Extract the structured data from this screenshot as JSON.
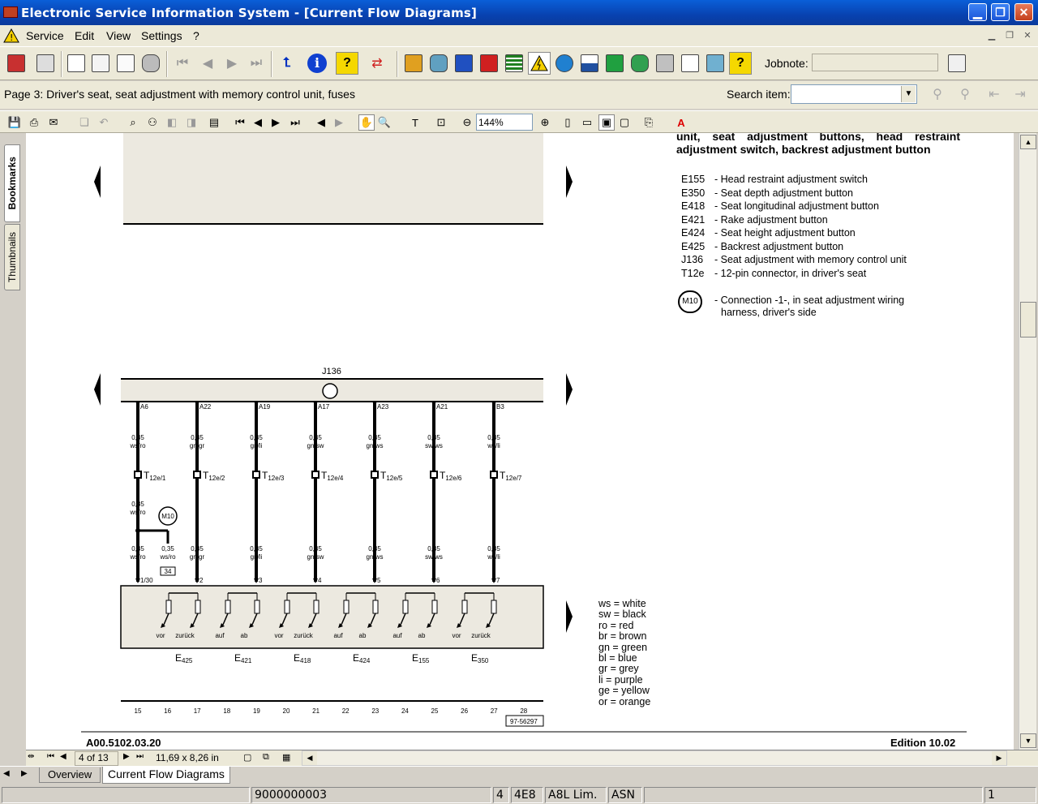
{
  "window": {
    "title": "Electronic Service Information System - [Current Flow Diagrams]"
  },
  "menu": [
    "Service",
    "Edit",
    "View",
    "Settings",
    "?"
  ],
  "toolbar": {
    "jobnote_label": "Jobnote:",
    "jobnote_value": ""
  },
  "pagebar": {
    "page_title": "Page 3: Driver's seat, seat adjustment with memory control unit, fuses",
    "search_label": "Search item:",
    "search_value": ""
  },
  "viewer": {
    "zoom": "144%",
    "page_indicator": "4 of 13",
    "page_size": "11,69 x 8,26 in"
  },
  "side_tabs": [
    "Bookmarks",
    "Thumbnails"
  ],
  "document": {
    "heading_line1": "unit, seat adjustment buttons, head restraint",
    "heading_line2": "adjustment switch, backrest adjustment button",
    "components": [
      {
        "code": "E155",
        "desc": "- Head restraint adjustment switch"
      },
      {
        "code": "E350",
        "desc": "- Seat depth adjustment button"
      },
      {
        "code": "E418",
        "desc": "- Seat longitudinal adjustment button"
      },
      {
        "code": "E421",
        "desc": "- Rake adjustment button"
      },
      {
        "code": "E424",
        "desc": "- Seat height adjustment button"
      },
      {
        "code": "E425",
        "desc": "- Backrest adjustment button"
      },
      {
        "code": "J136",
        "desc": "- Seat adjustment with memory control unit"
      },
      {
        "code": "T12e",
        "desc": "- 12-pin connector, in driver's seat"
      }
    ],
    "connection": {
      "code": "M10",
      "desc_line1": "- Connection -1-, in seat adjustment wiring",
      "desc_line2": "harness, driver's side"
    },
    "color_legend": [
      "ws = white",
      "sw = black",
      "ro = red",
      "br = brown",
      "gn = green",
      "bl = blue",
      "gr = grey",
      "li = purple",
      "ge = yellow",
      "or = orange"
    ],
    "control_unit": "J136",
    "wires": [
      {
        "pin": "A6",
        "gauge": "0,35",
        "color": "ws/ro",
        "conn": "T12e/1",
        "bottom_color": "ws/ro",
        "term": "1/30"
      },
      {
        "pin": "A22",
        "gauge": "0,35",
        "color": "gn/gr",
        "conn": "T12e/2",
        "bottom_color": "gn/gr",
        "term": "2"
      },
      {
        "pin": "A19",
        "gauge": "0,35",
        "color": "gn/li",
        "conn": "T12e/3",
        "bottom_color": "gn/li",
        "term": "3"
      },
      {
        "pin": "A17",
        "gauge": "0,35",
        "color": "gn/sw",
        "conn": "T12e/4",
        "bottom_color": "gn/sw",
        "term": "4"
      },
      {
        "pin": "A23",
        "gauge": "0,35",
        "color": "gn/ws",
        "conn": "T12e/5",
        "bottom_color": "gn/ws",
        "term": "5"
      },
      {
        "pin": "A21",
        "gauge": "0,35",
        "color": "sw/ws",
        "conn": "T12e/6",
        "bottom_color": "sw/ws",
        "term": "6"
      },
      {
        "pin": "B3",
        "gauge": "0,35",
        "color": "ws/li",
        "conn": "T12e/7",
        "bottom_color": "ws/li",
        "term": "7"
      }
    ],
    "m10_wire": {
      "gauge": "0,35",
      "color": "ws/ro",
      "label": "M10",
      "box": "34"
    },
    "switches": [
      {
        "code": "E425",
        "labels": [
          "vor",
          "zurück"
        ]
      },
      {
        "code": "E421",
        "labels": [
          "auf",
          "ab"
        ]
      },
      {
        "code": "E418",
        "labels": [
          "vor",
          "zurück"
        ]
      },
      {
        "code": "E424",
        "labels": [
          "auf",
          "ab"
        ]
      },
      {
        "code": "E155",
        "labels": [
          "auf",
          "ab"
        ]
      },
      {
        "code": "E350",
        "labels": [
          "vor",
          "zurück"
        ]
      }
    ],
    "footer_numbers": [
      "15",
      "16",
      "17",
      "18",
      "19",
      "20",
      "21",
      "22",
      "23",
      "24",
      "25",
      "26",
      "27",
      "28"
    ],
    "drawing_number": "97-56297",
    "doc_code": "A00.5102.03.20",
    "edition": "Edition 10.02"
  },
  "tabs": [
    "Overview",
    "Current Flow Diagrams"
  ],
  "status": [
    "9000000003",
    "4",
    "4E8",
    "A8L Lim.",
    "ASN",
    "1"
  ]
}
